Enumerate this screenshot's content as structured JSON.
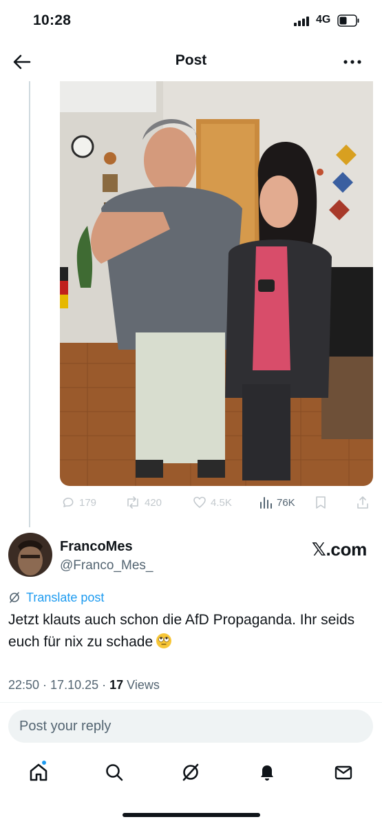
{
  "status_bar": {
    "time": "10:28",
    "network": "4G"
  },
  "header": {
    "title": "Post"
  },
  "quoted_post": {
    "stats": {
      "replies": "179",
      "reposts": "420",
      "likes": "4.5K",
      "views": "76K"
    }
  },
  "author": {
    "name": "FrancoMes",
    "handle": "@Franco_Mes_",
    "watermark": "𝕏.com"
  },
  "post": {
    "translate_label": "Translate post",
    "text": "Jetzt klauts auch schon die AfD Propaganda. Ihr seids euch für nix zu schade",
    "time": "22:50",
    "date": "17.10.25",
    "views_count": "17",
    "views_label": "Views"
  },
  "reply": {
    "placeholder": "Post your reply"
  },
  "nav": {
    "items": [
      "home-icon",
      "search-icon",
      "grok-icon",
      "notifications-icon",
      "messages-icon"
    ]
  },
  "colors": {
    "accent": "#1d9bf0",
    "text": "#0f1419",
    "secondary": "#536471"
  }
}
